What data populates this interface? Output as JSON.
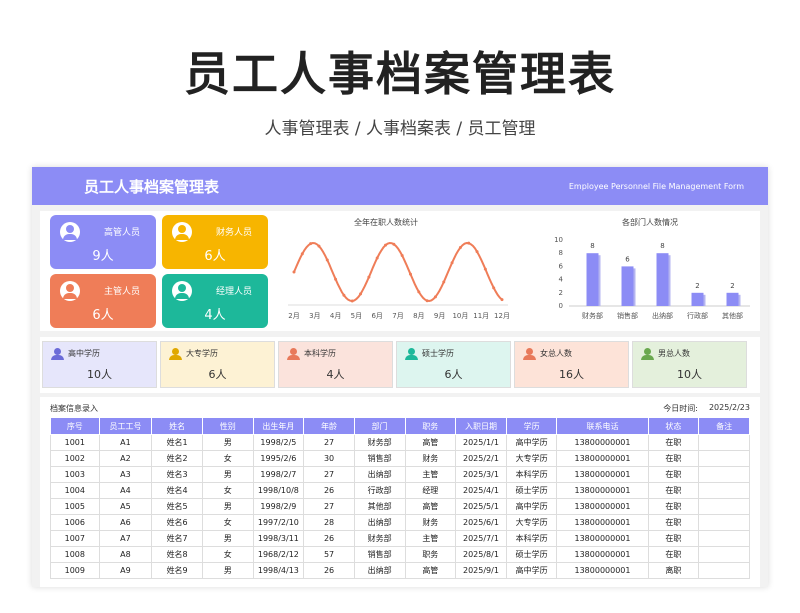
{
  "title": "员工人事档案管理表",
  "subtitle": "人事管理表 / 人事档案表 / 员工管理",
  "banner": {
    "title": "员工人事档案管理表",
    "english": "Employee Personnel File Management Form"
  },
  "cards": [
    {
      "label": "高管人员",
      "value": "9人",
      "color": "#8c8cf5"
    },
    {
      "label": "财务人员",
      "value": "6人",
      "color": "#f7b500"
    },
    {
      "label": "主管人员",
      "value": "6人",
      "color": "#ef7d58"
    },
    {
      "label": "经理人员",
      "value": "4人",
      "color": "#1db89a"
    }
  ],
  "chart_data": [
    {
      "type": "line",
      "title": "全年在职人数统计",
      "categories": [
        "2月",
        "3月",
        "4月",
        "5月",
        "6月",
        "7月",
        "8月",
        "9月",
        "10月",
        "11月",
        "12月"
      ],
      "color": "#ef7d58"
    },
    {
      "type": "bar",
      "title": "各部门人数情况",
      "categories": [
        "财务部",
        "销售部",
        "出纳部",
        "行政部",
        "其他部"
      ],
      "values": [
        8,
        6,
        8,
        2,
        2
      ],
      "ylim": [
        0,
        10
      ],
      "yticks": [
        "0",
        "2",
        "4",
        "6",
        "8",
        "10"
      ],
      "color": "#8c8cf5"
    }
  ],
  "edu": [
    {
      "label": "高中学历",
      "value": "10人",
      "bg": "#e6e6fb",
      "color": "#6b6bd8"
    },
    {
      "label": "大专学历",
      "value": "6人",
      "bg": "#fdf2d4",
      "color": "#e0a800"
    },
    {
      "label": "本科学历",
      "value": "4人",
      "bg": "#fbe3dc",
      "color": "#e8795a"
    },
    {
      "label": "硕士学历",
      "value": "6人",
      "bg": "#ddf5ef",
      "color": "#1db89a"
    },
    {
      "label": "女总人数",
      "value": "16人",
      "bg": "#fde3d8",
      "color": "#e8795a"
    },
    {
      "label": "男总人数",
      "value": "10人",
      "bg": "#e4f0dc",
      "color": "#6aa84f"
    }
  ],
  "table": {
    "title": "档案信息录入",
    "date_label": "今日时间:",
    "date": "2025/2/23",
    "headers": [
      "序号",
      "员工工号",
      "姓名",
      "性别",
      "出生年月",
      "年龄",
      "部门",
      "职务",
      "入职日期",
      "学历",
      "联系电话",
      "状态",
      "备注"
    ],
    "rows": [
      [
        "1001",
        "A1",
        "姓名1",
        "男",
        "1998/2/5",
        "27",
        "财务部",
        "高管",
        "2025/1/1",
        "高中学历",
        "13800000001",
        "在职",
        ""
      ],
      [
        "1002",
        "A2",
        "姓名2",
        "女",
        "1995/2/6",
        "30",
        "销售部",
        "财务",
        "2025/2/1",
        "大专学历",
        "13800000001",
        "在职",
        ""
      ],
      [
        "1003",
        "A3",
        "姓名3",
        "男",
        "1998/2/7",
        "27",
        "出纳部",
        "主管",
        "2025/3/1",
        "本科学历",
        "13800000001",
        "在职",
        ""
      ],
      [
        "1004",
        "A4",
        "姓名4",
        "女",
        "1998/10/8",
        "26",
        "行政部",
        "经理",
        "2025/4/1",
        "硕士学历",
        "13800000001",
        "在职",
        ""
      ],
      [
        "1005",
        "A5",
        "姓名5",
        "男",
        "1998/2/9",
        "27",
        "其他部",
        "高管",
        "2025/5/1",
        "高中学历",
        "13800000001",
        "在职",
        ""
      ],
      [
        "1006",
        "A6",
        "姓名6",
        "女",
        "1997/2/10",
        "28",
        "出纳部",
        "财务",
        "2025/6/1",
        "大专学历",
        "13800000001",
        "在职",
        ""
      ],
      [
        "1007",
        "A7",
        "姓名7",
        "男",
        "1998/3/11",
        "26",
        "财务部",
        "主管",
        "2025/7/1",
        "本科学历",
        "13800000001",
        "在职",
        ""
      ],
      [
        "1008",
        "A8",
        "姓名8",
        "女",
        "1968/2/12",
        "57",
        "销售部",
        "职务",
        "2025/8/1",
        "硕士学历",
        "13800000001",
        "在职",
        ""
      ],
      [
        "1009",
        "A9",
        "姓名9",
        "男",
        "1998/4/13",
        "26",
        "出纳部",
        "高管",
        "2025/9/1",
        "高中学历",
        "13800000001",
        "离职",
        ""
      ]
    ]
  }
}
